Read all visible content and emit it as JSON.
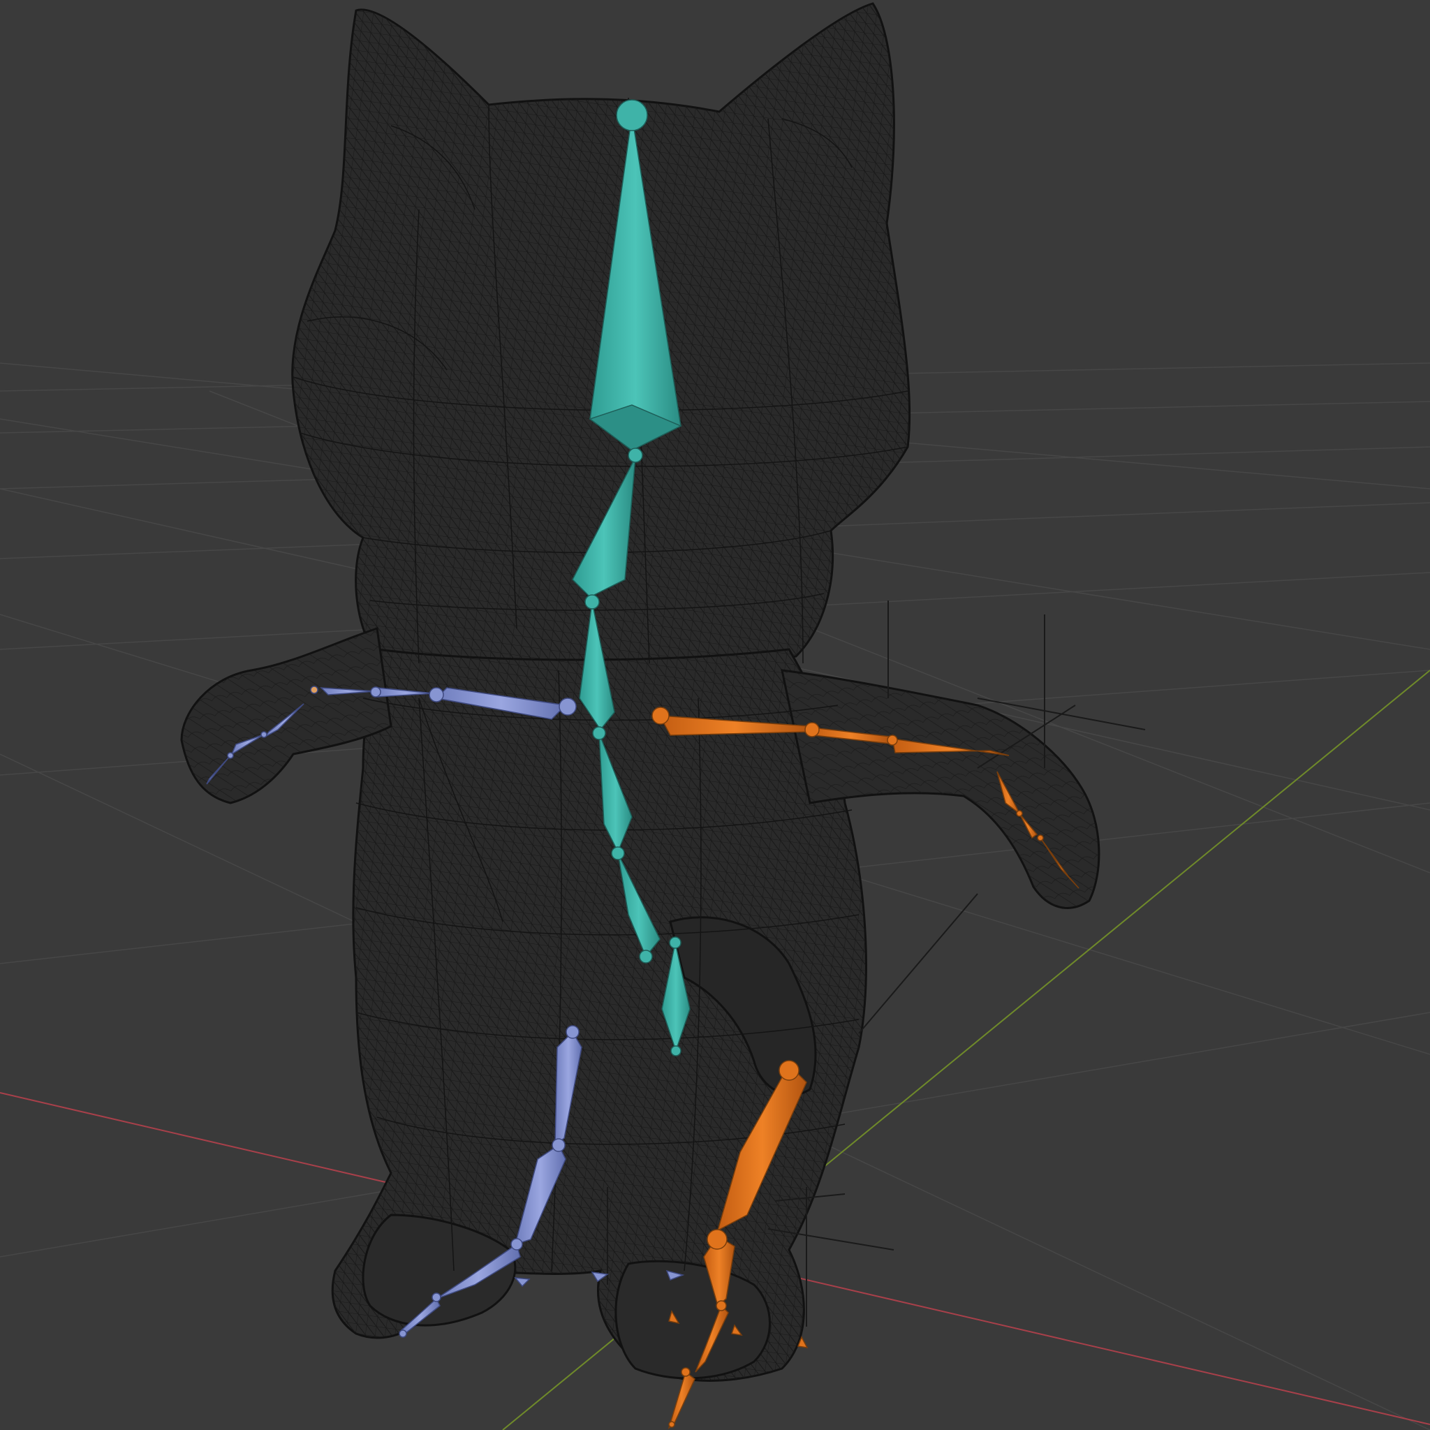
{
  "viewport": {
    "mode": "3d-viewport",
    "background_color": "#3a3a3a",
    "grid_color": "#4a4a4a",
    "x_axis_color": "#c0444a",
    "y_axis_color": "#7c9a2c",
    "wireframe_color": "#111111"
  },
  "armature": {
    "center_bones_color": "#3fb3a8",
    "left_side_color": "#8795d2",
    "right_side_color": "#e0731c",
    "center_bone_count": 7,
    "left_arm_bone_count": 6,
    "right_arm_bone_count": 6,
    "left_leg_bone_count": 5,
    "right_leg_bone_count": 5
  }
}
